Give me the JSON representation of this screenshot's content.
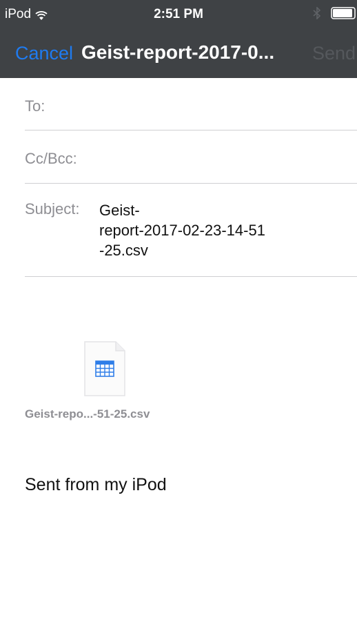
{
  "status_bar": {
    "carrier": "iPod",
    "time": "2:51 PM",
    "icons": [
      "wifi-icon",
      "bluetooth-icon",
      "battery-icon"
    ]
  },
  "nav": {
    "cancel_label": "Cancel",
    "title": "Geist-report-2017-0...",
    "send_label": "Send"
  },
  "fields": {
    "to_label": "To:",
    "cc_label": "Cc/Bcc:",
    "subject_label": "Subject:",
    "subject_lines": [
      "Geist-",
      "report-2017-02-23-14-51",
      "-25.csv"
    ]
  },
  "attachment": {
    "icon": "spreadsheet-file-icon",
    "name": "Geist-repo...-51-25.csv"
  },
  "body": {
    "signature": "Sent from my iPod"
  },
  "colors": {
    "header_bg": "#3f4245",
    "accent": "#1f7bf0",
    "label_gray": "#8e8e93"
  }
}
